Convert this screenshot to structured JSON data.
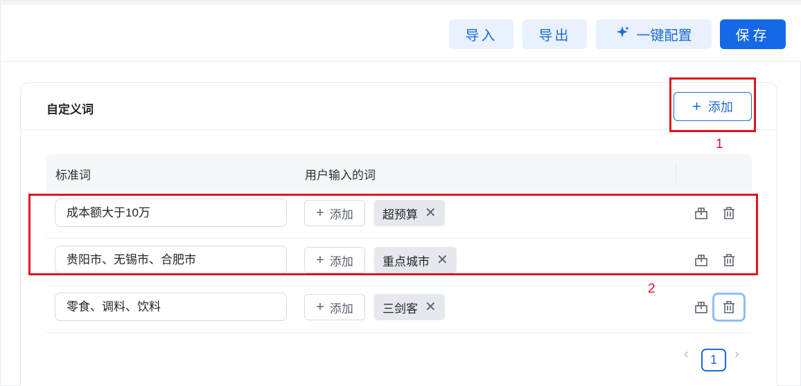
{
  "toolbar": {
    "import_label": "导入",
    "export_label": "导出",
    "one_click_label": "一键配置",
    "save_label": "保存"
  },
  "section": {
    "title": "自定义词",
    "add_label": "添加"
  },
  "table": {
    "headers": [
      "标准词",
      "用户输入的词"
    ],
    "add_label": "添加",
    "rows": [
      {
        "standard": "成本额大于10万",
        "tags": [
          "超预算"
        ]
      },
      {
        "standard": "贵阳市、无锡市、合肥市",
        "tags": [
          "重点城市"
        ]
      },
      {
        "standard": "零食、调料、饮料",
        "tags": [
          "三剑客"
        ]
      }
    ]
  },
  "annotations": {
    "label_1": "1",
    "label_2": "2",
    "color": "#e0141e"
  },
  "pagination": {
    "current": "1"
  },
  "colors": {
    "primary": "#1669e6",
    "primary_light": "#e8f1fd",
    "tag_bg": "#e5e8ed"
  },
  "icons": {
    "one_click": "sparkle-icon",
    "row_action_1": "copy-icon",
    "row_action_2": "trash-icon",
    "tag_remove": "close-icon",
    "page_prev": "chevron-left-icon",
    "page_next": "chevron-right-icon"
  }
}
